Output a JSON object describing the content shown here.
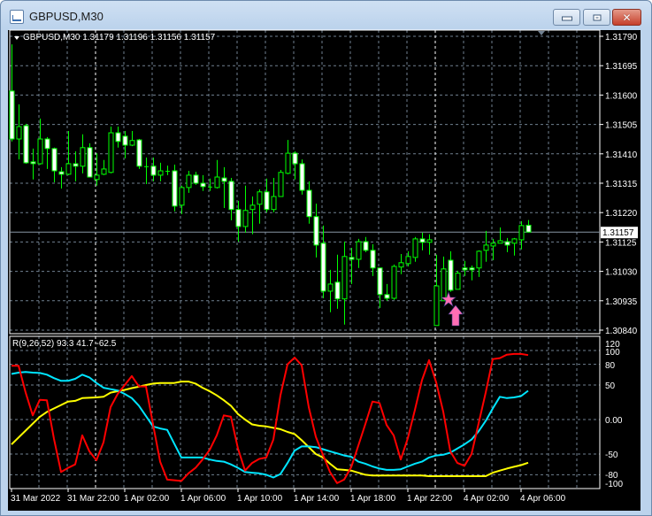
{
  "window": {
    "title": "GBPUSD,M30",
    "buttons": {
      "minimize": "minimize",
      "maximize": "maximize",
      "close": "✕"
    }
  },
  "chart": {
    "header": "GBPUSD,M30  1.31179 1.31196 1.31156 1.31157",
    "current_price": "1.31157",
    "price_labels": [
      "1.31790",
      "1.31695",
      "1.31600",
      "1.31505",
      "1.31410",
      "1.31315",
      "1.31220",
      "1.31125",
      "1.31030",
      "1.30935",
      "1.30840"
    ],
    "time_labels": [
      "31 Mar 2022",
      "31 Mar 22:00",
      "1 Apr 02:00",
      "1 Apr 06:00",
      "1 Apr 10:00",
      "1 Apr 14:00",
      "1 Apr 18:00",
      "1 Apr 22:00",
      "4 Apr 02:00",
      "4 Apr 06:00"
    ],
    "colors": {
      "bull": "#00ff00",
      "bear_body": "#ffffff",
      "grid": "#708090",
      "background": "#000000",
      "signal": "#ff6eb4"
    }
  },
  "indicator": {
    "header": "R(9,26,52) 93.3 41.7 -62.5",
    "scale_labels": [
      "120",
      "100",
      "80",
      "50",
      "0.00",
      "-50",
      "-80",
      "-100"
    ],
    "colors": {
      "fast": "#ff0000",
      "mid": "#00e5ff",
      "slow": "#ffff00"
    }
  },
  "chart_data": {
    "type": "candlestick",
    "symbol": "GBPUSD",
    "timeframe": "M30",
    "ylim": [
      1.3084,
      1.3179
    ],
    "candles_ohlc": [
      [
        1.31613,
        1.31764,
        1.3145,
        1.31458
      ],
      [
        1.31458,
        1.3157,
        1.31392,
        1.31498
      ],
      [
        1.31501,
        1.31507,
        1.31378,
        1.31381
      ],
      [
        1.31384,
        1.31427,
        1.31327,
        1.31381
      ],
      [
        1.31378,
        1.31524,
        1.31375,
        1.31458
      ],
      [
        1.31458,
        1.31464,
        1.31361,
        1.31427
      ],
      [
        1.31427,
        1.3143,
        1.31318,
        1.31355
      ],
      [
        1.31352,
        1.31367,
        1.31298,
        1.31344
      ],
      [
        1.31344,
        1.31484,
        1.31341,
        1.31378
      ],
      [
        1.31378,
        1.31418,
        1.31321,
        1.3137
      ],
      [
        1.3137,
        1.31473,
        1.31347,
        1.3143
      ],
      [
        1.3143,
        1.31444,
        1.31335,
        1.31335
      ],
      [
        1.31327,
        1.31412,
        1.31307,
        1.31341
      ],
      [
        1.31344,
        1.3139,
        1.31341,
        1.31361
      ],
      [
        1.3135,
        1.31498,
        1.31347,
        1.31478
      ],
      [
        1.31478,
        1.31498,
        1.3143,
        1.3145
      ],
      [
        1.31467,
        1.31484,
        1.31395,
        1.31438
      ],
      [
        1.31438,
        1.31484,
        1.31435,
        1.31453
      ],
      [
        1.31455,
        1.31458,
        1.31361,
        1.3137
      ],
      [
        1.3137,
        1.31398,
        1.31312,
        1.3137
      ],
      [
        1.3137,
        1.31398,
        1.31321,
        1.31341
      ],
      [
        1.31341,
        1.31381,
        1.31321,
        1.31355
      ],
      [
        1.31355,
        1.31372,
        1.31341,
        1.31355
      ],
      [
        1.31355,
        1.31375,
        1.31224,
        1.31241
      ],
      [
        1.31244,
        1.31307,
        1.31215,
        1.31301
      ],
      [
        1.31301,
        1.31355,
        1.31284,
        1.31341
      ],
      [
        1.31341,
        1.31352,
        1.3131,
        1.31315
      ],
      [
        1.31315,
        1.31341,
        1.3129,
        1.31304
      ],
      [
        1.31304,
        1.3133,
        1.3129,
        1.31304
      ],
      [
        1.31301,
        1.3139,
        1.31298,
        1.31335
      ],
      [
        1.31332,
        1.31367,
        1.31235,
        1.31321
      ],
      [
        1.31321,
        1.31332,
        1.31195,
        1.3123
      ],
      [
        1.3123,
        1.31258,
        1.31126,
        1.31175
      ],
      [
        1.31175,
        1.31307,
        1.31155,
        1.31227
      ],
      [
        1.3123,
        1.31272,
        1.3115,
        1.31244
      ],
      [
        1.31247,
        1.31295,
        1.31184,
        1.31287
      ],
      [
        1.31287,
        1.3133,
        1.31221,
        1.3123
      ],
      [
        1.3123,
        1.31332,
        1.31221,
        1.31272
      ],
      [
        1.31272,
        1.31358,
        1.31272,
        1.3135
      ],
      [
        1.31347,
        1.31455,
        1.31344,
        1.31412
      ],
      [
        1.31412,
        1.31418,
        1.31327,
        1.31378
      ],
      [
        1.31378,
        1.31392,
        1.31278,
        1.31292
      ],
      [
        1.31292,
        1.31321,
        1.31184,
        1.31207
      ],
      [
        1.31207,
        1.31249,
        1.31075,
        1.31115
      ],
      [
        1.31121,
        1.31178,
        1.30943,
        1.30966
      ],
      [
        1.30966,
        1.31035,
        1.30898,
        1.30989
      ],
      [
        1.30995,
        1.31084,
        1.30909,
        1.30941
      ],
      [
        1.30941,
        1.31126,
        1.30858,
        1.31078
      ],
      [
        1.31075,
        1.31106,
        1.30989,
        1.31069
      ],
      [
        1.31069,
        1.31135,
        1.31041,
        1.31126
      ],
      [
        1.31126,
        1.31141,
        1.31092,
        1.31098
      ],
      [
        1.31098,
        1.31118,
        1.31015,
        1.31041
      ],
      [
        1.31041,
        1.31041,
        1.30912,
        1.30955
      ],
      [
        1.30955,
        1.30989,
        1.30935,
        1.30943
      ],
      [
        1.30943,
        1.31052,
        1.30938,
        1.31046
      ],
      [
        1.31044,
        1.31086,
        1.31021,
        1.31058
      ],
      [
        1.31055,
        1.31095,
        1.31046,
        1.31078
      ],
      [
        1.31075,
        1.31141,
        1.31061,
        1.31135
      ],
      [
        1.31135,
        1.31155,
        1.31098,
        1.31124
      ],
      [
        1.31124,
        1.3115,
        1.31084,
        1.31132
      ],
      [
        1.30855,
        1.31084,
        1.30855,
        1.30983
      ],
      [
        1.30935,
        1.31078,
        1.30935,
        1.31038
      ],
      [
        1.31066,
        1.31095,
        1.30964,
        1.30969
      ],
      [
        1.30972,
        1.31032,
        1.30972,
        1.31024
      ],
      [
        1.31041,
        1.31064,
        1.31015,
        1.31035
      ],
      [
        1.31041,
        1.31049,
        1.31001,
        1.31035
      ],
      [
        1.31041,
        1.31098,
        1.31012,
        1.31095
      ],
      [
        1.31098,
        1.31161,
        1.31061,
        1.31115
      ],
      [
        1.31112,
        1.31135,
        1.31066,
        1.31121
      ],
      [
        1.31121,
        1.31172,
        1.31121,
        1.31129
      ],
      [
        1.31126,
        1.31138,
        1.31092,
        1.31115
      ],
      [
        1.31121,
        1.31138,
        1.31081,
        1.31135
      ],
      [
        1.31132,
        1.31192,
        1.31101,
        1.31178
      ],
      [
        1.31179,
        1.31196,
        1.31156,
        1.31157
      ]
    ],
    "indicator": {
      "name": "R(9,26,52)",
      "ylim": [
        -100,
        120
      ],
      "levels": [
        100,
        80,
        50,
        0,
        -50,
        -80
      ],
      "series": [
        {
          "name": "9",
          "values": [
            78,
            78,
            39,
            6,
            28.6,
            28,
            -28,
            -76,
            -70,
            -65,
            -23,
            -46,
            -59,
            -33,
            18,
            37,
            50,
            63,
            48,
            48,
            -7,
            -61,
            -87,
            -88,
            -89,
            -78,
            -70,
            -58,
            -44,
            -23,
            6,
            4,
            -42,
            -74,
            -63,
            -57,
            -55,
            -29,
            35,
            80,
            89.7,
            78.6,
            18,
            -25,
            -51,
            -76,
            -92,
            -87,
            -69,
            -38,
            -6.5,
            26,
            24,
            -8,
            -23,
            -58,
            -27,
            14,
            57,
            86,
            54,
            11.5,
            -46,
            -63,
            -67,
            -50,
            -5.6,
            39,
            87.6,
            89,
            94,
            95,
            95,
            93.3
          ]
        },
        {
          "name": "26",
          "values": [
            66,
            68,
            69,
            68,
            67.5,
            65,
            60,
            56,
            56,
            59,
            65,
            61,
            53,
            46,
            44,
            42,
            37,
            31,
            20,
            5,
            -10,
            -13,
            -15,
            -35,
            -55,
            -55,
            -55,
            -55,
            -58,
            -60,
            -61,
            -65,
            -70,
            -76,
            -77,
            -78,
            -80,
            -84,
            -79,
            -63,
            -45,
            -39,
            -39,
            -40,
            -43,
            -46,
            -49,
            -52,
            -54,
            -61,
            -64,
            -68,
            -71,
            -73,
            -73,
            -72,
            -68,
            -64,
            -61,
            -55,
            -52,
            -51,
            -48,
            -42,
            -36,
            -29,
            -17,
            -2,
            16,
            33,
            31,
            32,
            34,
            41.7
          ]
        },
        {
          "name": "52",
          "values": [
            -36,
            -26,
            -16,
            -6,
            4,
            11,
            16,
            21,
            26,
            27,
            31,
            31.5,
            32,
            33,
            39,
            41,
            43,
            45.5,
            47.5,
            50,
            52,
            53,
            53,
            53,
            55,
            55,
            52,
            46,
            41,
            35,
            28,
            20,
            8,
            0,
            -7,
            -9,
            -10,
            -12,
            -14,
            -18,
            -21,
            -30,
            -40,
            -50,
            -55,
            -64,
            -72,
            -73,
            -74,
            -77,
            -80,
            -81,
            -81,
            -81,
            -81,
            -81,
            -81,
            -81,
            -81,
            -82,
            -82,
            -82,
            -82,
            -82,
            -82,
            -82,
            -82,
            -82,
            -77,
            -74,
            -71,
            -68.5,
            -66,
            -62.5
          ]
        }
      ]
    }
  }
}
